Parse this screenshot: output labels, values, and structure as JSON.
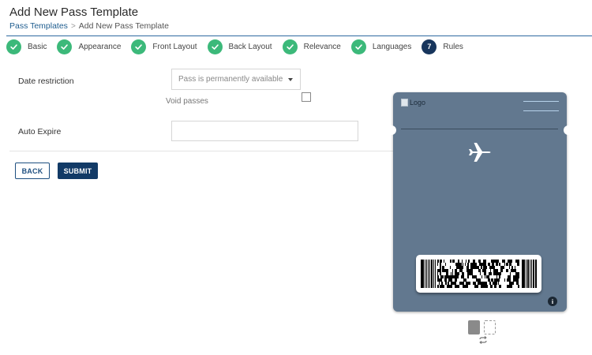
{
  "page": {
    "title": "Add New Pass Template"
  },
  "breadcrumb": {
    "parent": "Pass Templates",
    "separator": ">",
    "current": "Add New Pass Template"
  },
  "steps": [
    {
      "label": "Basic",
      "status": "complete"
    },
    {
      "label": "Appearance",
      "status": "complete"
    },
    {
      "label": "Front Layout",
      "status": "complete"
    },
    {
      "label": "Back Layout",
      "status": "complete"
    },
    {
      "label": "Relevance",
      "status": "complete"
    },
    {
      "label": "Languages",
      "status": "complete"
    },
    {
      "label": "Rules",
      "status": "active",
      "number": "7"
    }
  ],
  "form": {
    "date_restriction": {
      "label": "Date restriction",
      "selected": "Pass is permanently available"
    },
    "void_passes": {
      "label": "Void passes",
      "checked": false
    },
    "auto_expire": {
      "label": "Auto Expire",
      "value": ""
    }
  },
  "buttons": {
    "back": "BACK",
    "submit": "SUBMIT"
  },
  "preview": {
    "logo_alt": "Logo",
    "transit_icon": "airplane-icon",
    "info": "i",
    "background_color": "#62788f"
  },
  "colors": {
    "complete": "#3cb97a",
    "active": "#17355c",
    "accent": "#123a66"
  }
}
